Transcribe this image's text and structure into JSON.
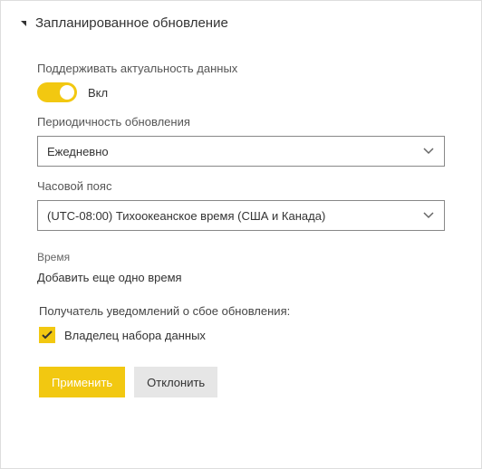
{
  "section": {
    "title": "Запланированное обновление"
  },
  "keepData": {
    "label": "Поддерживать актуальность данных",
    "toggleState": "Вкл"
  },
  "frequency": {
    "label": "Периодичность обновления",
    "value": "Ежедневно"
  },
  "timezone": {
    "label": "Часовой пояс",
    "value": "(UTC-08:00) Тихоокеанское время (США и Канада)"
  },
  "time": {
    "label": "Время",
    "addLink": "Добавить еще одно время"
  },
  "notification": {
    "label": "Получатель уведомлений о сбое обновления:",
    "ownerLabel": "Владелец набора данных",
    "ownerChecked": true
  },
  "buttons": {
    "apply": "Применить",
    "discard": "Отклонить"
  }
}
